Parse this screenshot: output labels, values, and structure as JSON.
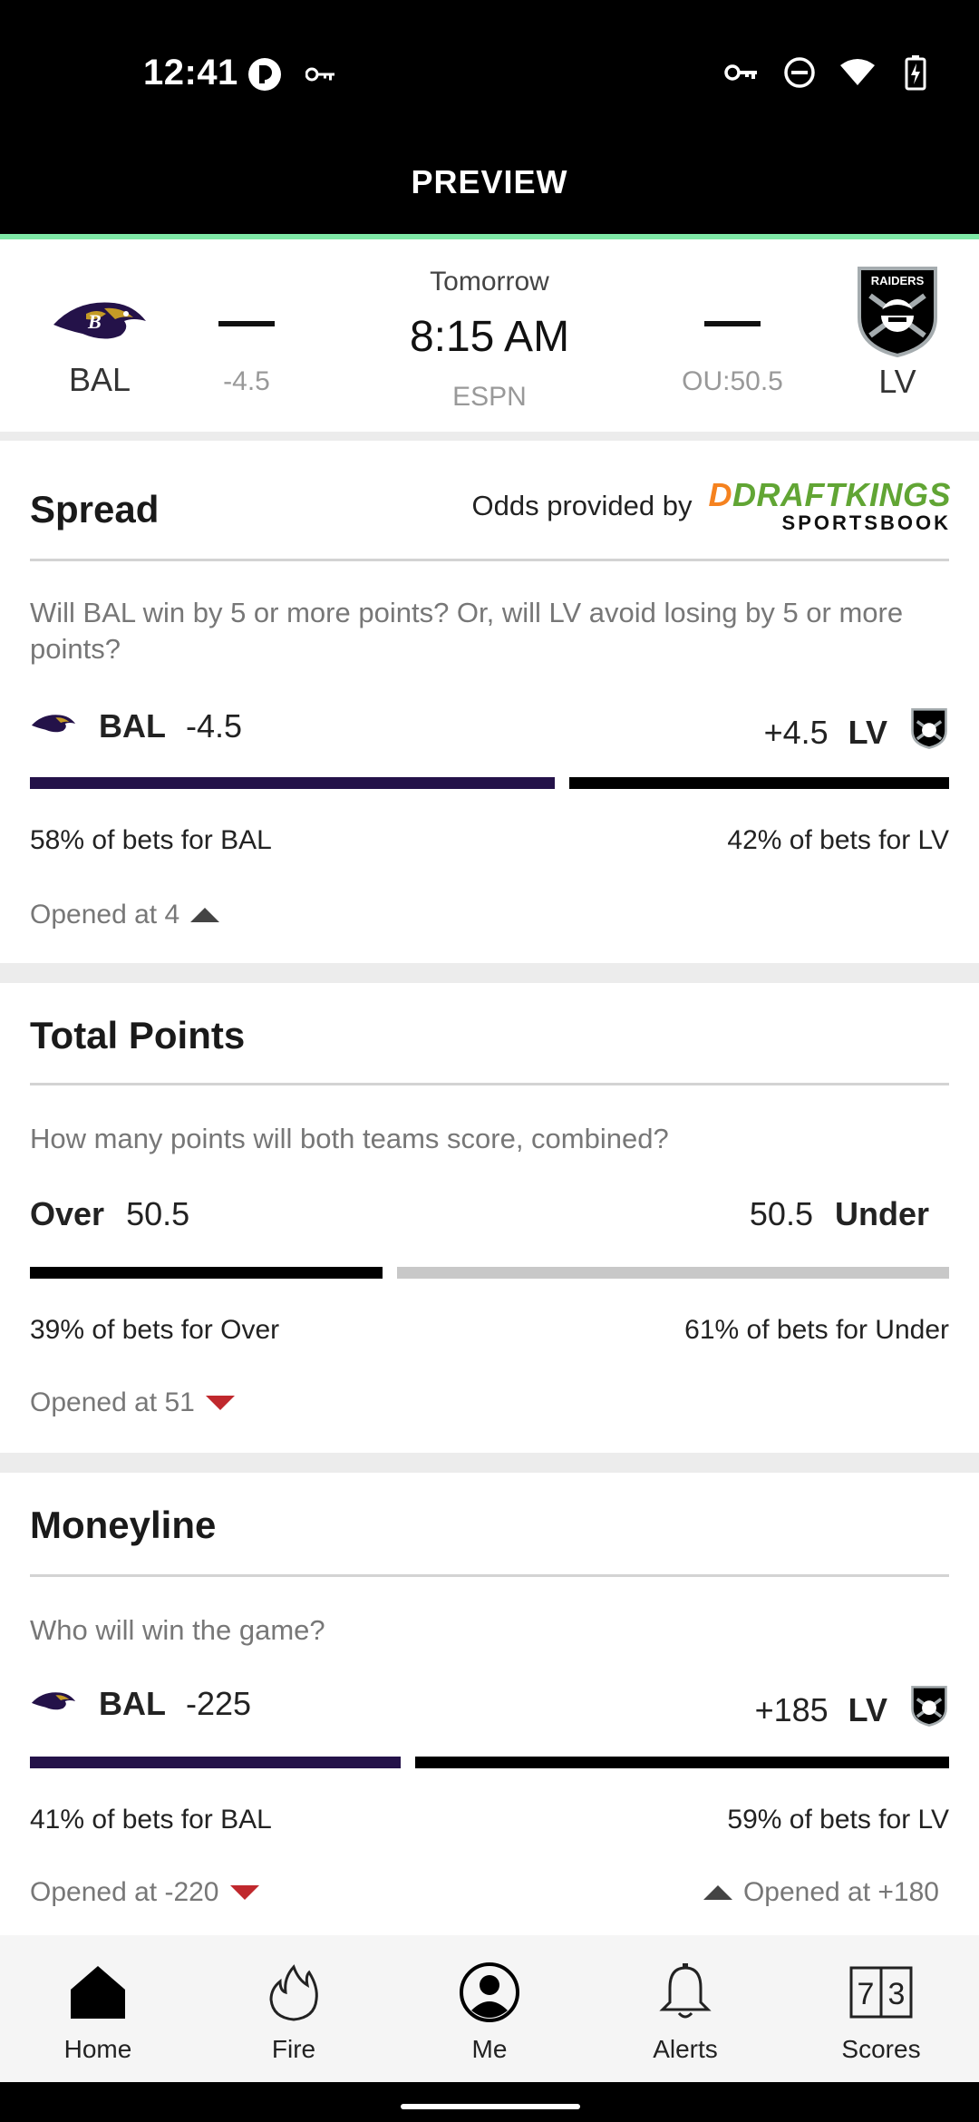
{
  "status_bar": {
    "time": "12:41",
    "left_icons": [
      "notification-app-icon",
      "key-icon"
    ],
    "right_icons": [
      "vpn-key-icon",
      "do-not-disturb-icon",
      "wifi-icon",
      "battery-charging-icon"
    ]
  },
  "header": {
    "title": "PREVIEW",
    "accent_color": "#7ee8a6"
  },
  "game": {
    "home_team": {
      "abbr": "BAL",
      "spread": "-4.5",
      "logo": "ravens-logo"
    },
    "away_team": {
      "abbr": "LV",
      "total": "OU:50.5",
      "logo": "raiders-logo"
    },
    "day": "Tomorrow",
    "time": "8:15 AM",
    "network": "ESPN",
    "home_score": "—",
    "away_score": "—"
  },
  "spread": {
    "title": "Spread",
    "odds_provider_prefix": "Odds provided by",
    "provider_name": "DRAFTKINGS",
    "provider_sub": "SPORTSBOOK",
    "question": "Will BAL win by 5 or more points? Or, will LV avoid losing by 5 or more points?",
    "left": {
      "team": "BAL",
      "line": "-4.5",
      "bet_pct": 58,
      "pct_text": "58% of bets for BAL",
      "bar_color": "#241249"
    },
    "right": {
      "team": "LV",
      "line": "+4.5",
      "bet_pct": 42,
      "pct_text": "42% of bets for LV",
      "bar_color": "#000000"
    },
    "opened": {
      "text": "Opened at 4",
      "direction": "up"
    }
  },
  "total": {
    "title": "Total Points",
    "question": "How many points will both teams score, combined?",
    "left": {
      "label": "Over",
      "line": "50.5",
      "bet_pct": 39,
      "pct_text": "39% of bets for Over",
      "bar_color": "#000000"
    },
    "right": {
      "label": "Under",
      "line": "50.5",
      "bet_pct": 61,
      "pct_text": "61% of bets for Under",
      "bar_color": "#c8c8c8"
    },
    "opened": {
      "text": "Opened at 51",
      "direction": "down"
    }
  },
  "moneyline": {
    "title": "Moneyline",
    "question": "Who will win the game?",
    "left": {
      "team": "BAL",
      "line": "-225",
      "bet_pct": 41,
      "pct_text": "41% of bets for BAL",
      "bar_color": "#241249",
      "opened": "Opened at -220",
      "opened_direction": "down"
    },
    "right": {
      "team": "LV",
      "line": "+185",
      "bet_pct": 59,
      "pct_text": "59% of bets for LV",
      "bar_color": "#000000",
      "opened": "Opened at +180",
      "opened_direction": "up"
    }
  },
  "nav": {
    "items": [
      {
        "label": "Home",
        "icon": "home-icon"
      },
      {
        "label": "Fire",
        "icon": "fire-icon"
      },
      {
        "label": "Me",
        "icon": "profile-icon"
      },
      {
        "label": "Alerts",
        "icon": "bell-icon"
      },
      {
        "label": "Scores",
        "icon": "scores-icon",
        "icon_digits": [
          "7",
          "3"
        ]
      }
    ]
  },
  "colors": {
    "ravens_purple": "#241249",
    "draftkings_orange": "#f5821f",
    "draftkings_green": "#61a534",
    "down_red": "#c0282d"
  }
}
